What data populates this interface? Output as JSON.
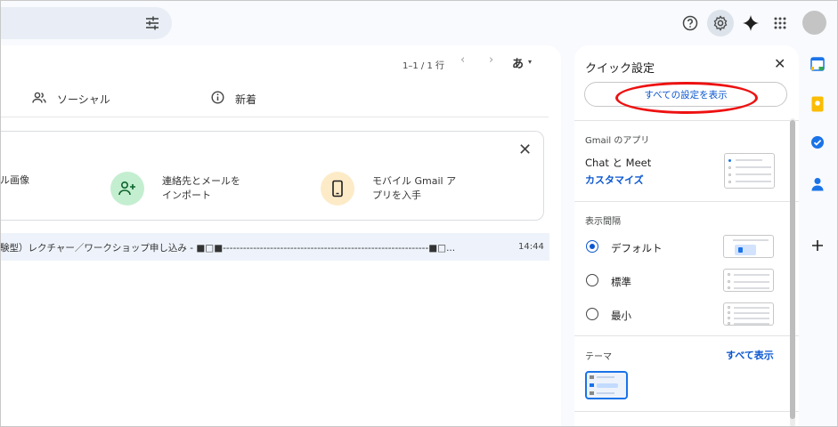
{
  "pager": {
    "range": "1–1 / 1 行",
    "prev": "‹",
    "next": "›"
  },
  "input_tool": {
    "label": "あ",
    "caret": "▾"
  },
  "tabs": [
    {
      "label": "ソーシャル"
    },
    {
      "label": "新着"
    }
  ],
  "onboarding": {
    "item1": "ル画像",
    "item2_line1": "連絡先とメールを",
    "item2_line2": "インポート",
    "item3_line1": "モバイル Gmail ア",
    "item3_line2": "プリを入手",
    "close": "✕"
  },
  "email": {
    "subject": "験型）レクチャー／ワークショップ申し込み - ■□■-------------------------------------------------------------■□...",
    "time": "14:44"
  },
  "quick_settings": {
    "title": "クイック設定",
    "close": "✕",
    "all_settings_button": "すべての設定を表示",
    "apps_section": "Gmail のアプリ",
    "chat_meet": "Chat と Meet",
    "customize": "カスタマイズ",
    "density_section": "表示間隔",
    "density_options": [
      {
        "label": "デフォルト",
        "selected": true
      },
      {
        "label": "標準",
        "selected": false
      },
      {
        "label": "最小",
        "selected": false
      }
    ],
    "theme_section": "テーマ",
    "show_all": "すべて表示"
  },
  "colors": {
    "accent": "#0b57d0",
    "annotation_red": "#e11111",
    "row_highlight": "#eef3fb"
  },
  "icons": {
    "header": [
      "search-options-icon",
      "help-icon",
      "settings-icon",
      "gemini-icon",
      "apps-grid-icon"
    ],
    "side": [
      "calendar-icon",
      "keep-icon",
      "tasks-icon",
      "contacts-icon",
      "add-icon"
    ]
  }
}
